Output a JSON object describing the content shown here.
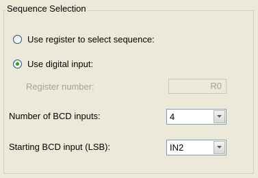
{
  "group": {
    "title": "Sequence Selection"
  },
  "options": {
    "use_register_label": "Use register to select sequence:",
    "use_register_checked": false,
    "use_digital_label": "Use digital input:",
    "use_digital_checked": true
  },
  "register_number": {
    "label": "Register number:",
    "value": "R0",
    "enabled": false
  },
  "bcd_inputs": {
    "label": "Number of BCD inputs:",
    "value": "4"
  },
  "starting_bcd": {
    "label": "Starting BCD input (LSB):",
    "value": "IN2"
  },
  "icons": {
    "dropdown": "chevron-down-icon"
  }
}
